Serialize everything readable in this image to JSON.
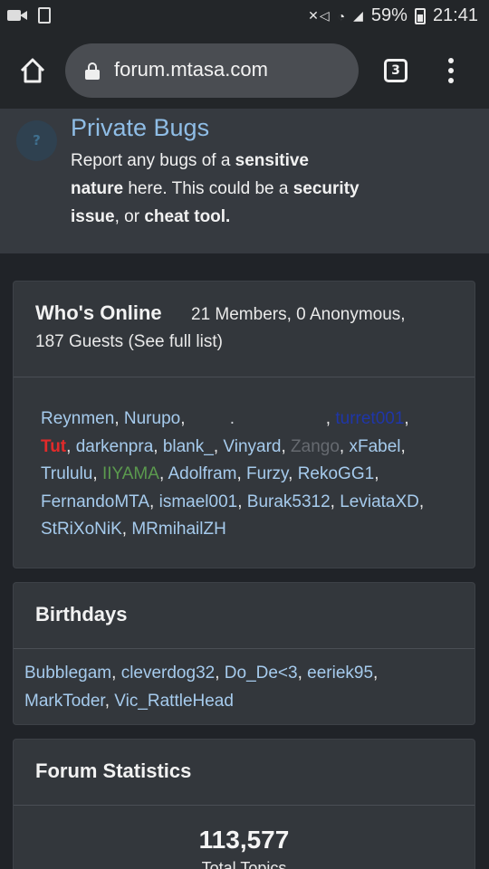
{
  "status_bar": {
    "battery": "59%",
    "time": "21:41",
    "left_icons": [
      "video-icon",
      "recycle-icon"
    ],
    "right_icons": [
      "mute-icon",
      "wifi-icon",
      "signal-icon",
      "battery-icon"
    ]
  },
  "browser": {
    "url": "forum.mtasa.com",
    "tab_count": "3"
  },
  "forum": {
    "title": "Private Bugs",
    "desc_1": "Report any bugs of a ",
    "desc_2": "sensitive",
    "desc_3": "nature",
    "desc_4": " here.  This could be a ",
    "desc_5": "security",
    "desc_6": "issue",
    "desc_7": ", or ",
    "desc_8": "cheat tool."
  },
  "online": {
    "title": "Who's Online",
    "summary_1": "21 Members, 0 Anonymous,",
    "summary_2": "187 Guests (See full list)",
    "users": [
      "Reynmen",
      "Nurupo",
      ".",
      "turret001",
      "Tut",
      "darkenpra",
      "blank_",
      "Vinyard",
      "Zango",
      "xFabel",
      "Trululu",
      "IIYAMA",
      "Adolfram",
      "Furzy",
      "RekoGG1",
      "FernandoMTA",
      "ismael001",
      "Burak5312",
      "LeviataXD",
      "StRiXoNiK",
      "MRmihailZH"
    ]
  },
  "birthdays": {
    "title": "Birthdays",
    "users": [
      "Bubblegam",
      "cleverdog32",
      "Do_De<3",
      "eeriek95",
      "MarkToder",
      "Vic_RattleHead"
    ]
  },
  "stats": {
    "title": "Forum Statistics",
    "total_topics_value": "113,577",
    "total_topics_label": "Total Topics"
  }
}
